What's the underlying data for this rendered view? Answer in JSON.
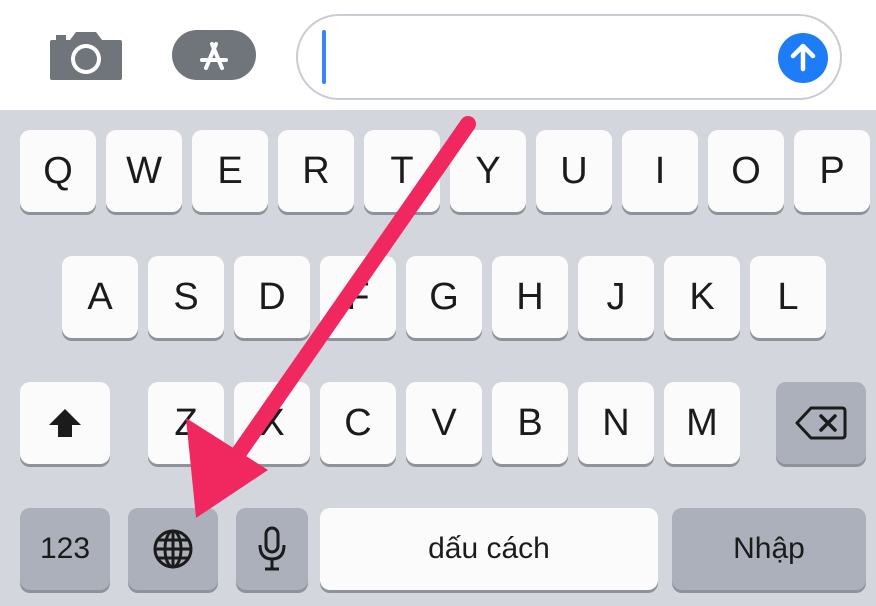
{
  "message_bar": {
    "camera_icon": "camera-icon",
    "appstore_icon": "appstore-icon",
    "input_value": "",
    "send_icon": "arrow-up-icon",
    "accent": "#1e7cf6"
  },
  "keyboard": {
    "row1": [
      "Q",
      "W",
      "E",
      "R",
      "T",
      "Y",
      "U",
      "I",
      "O",
      "P"
    ],
    "row2": [
      "A",
      "S",
      "D",
      "F",
      "G",
      "H",
      "J",
      "K",
      "L"
    ],
    "row3": [
      "Z",
      "X",
      "C",
      "V",
      "B",
      "N",
      "M"
    ],
    "numbers_label": "123",
    "space_label": "dấu cách",
    "return_label": "Nhập",
    "shift_icon": "shift-icon",
    "globe_icon": "globe-icon",
    "mic_icon": "microphone-icon",
    "delete_icon": "delete-backspace-icon"
  },
  "annotation": {
    "color": "#f0285f"
  }
}
